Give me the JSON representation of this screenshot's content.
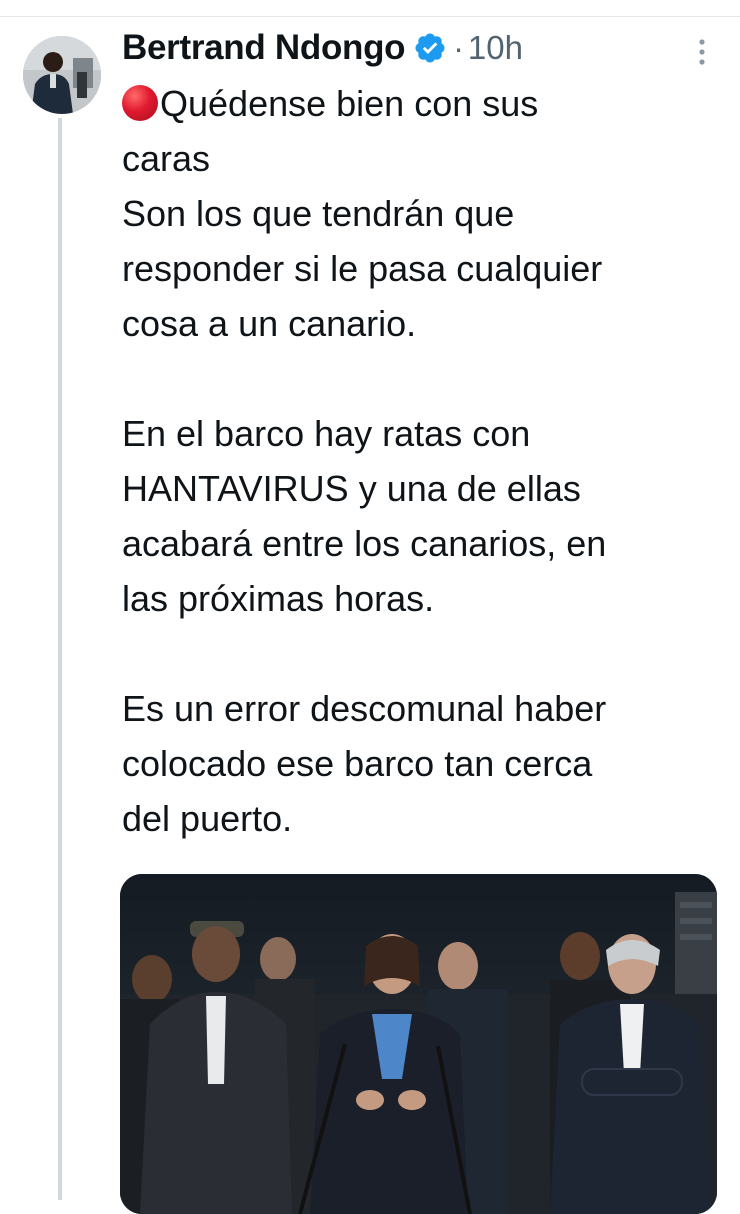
{
  "tweet": {
    "author_name": "Bertrand Ndongo",
    "separator": "·",
    "timestamp": "10h",
    "lines": [
      "Quédense bien con sus",
      "caras",
      "Son los que tendrán que",
      "responder si le pasa cualquier",
      "cosa a un canario.",
      "En el barco hay ratas con",
      "HANTAVIRUS y una de ellas",
      "acabará entre los canarios, en",
      "las próximas horas.",
      "Es un error descomunal haber",
      "colocado ese barco tan cerca",
      "del puerto."
    ]
  },
  "icons": {
    "verified": "verified-badge-icon",
    "more": "more-options-icon",
    "bullet": "red-circle-emoji"
  },
  "colors": {
    "verified_blue": "#1d9bf0",
    "text": "#0f1419",
    "secondary": "#536471",
    "thread_line": "#cfd9de"
  }
}
